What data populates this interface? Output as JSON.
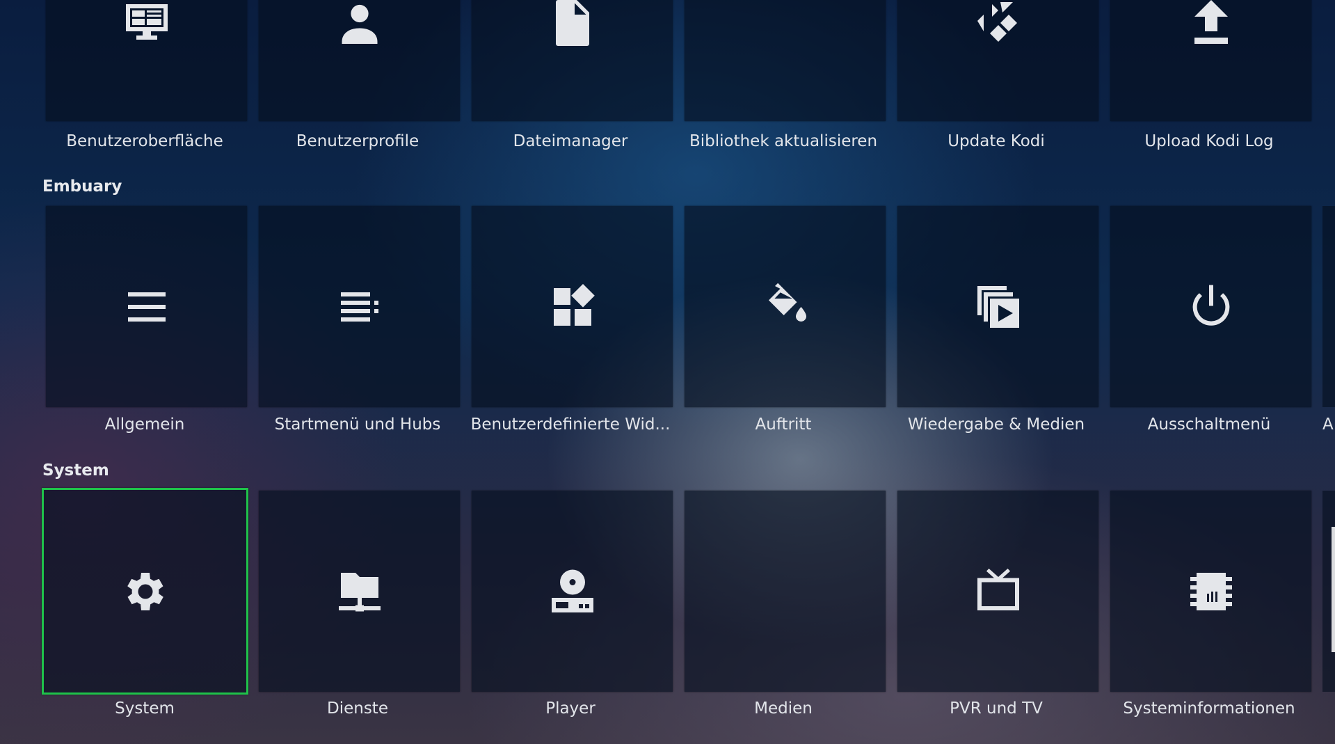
{
  "rows": [
    {
      "label": "",
      "tiles": [
        {
          "label": "Benutzeroberfläche",
          "icon": "monitor-layout-icon"
        },
        {
          "label": "Benutzerprofile",
          "icon": "user-icon"
        },
        {
          "label": "Dateimanager",
          "icon": "file-icon"
        },
        {
          "label": "Bibliothek aktualisieren",
          "icon": ""
        },
        {
          "label": "Update Kodi",
          "icon": "kodi-logo-icon"
        },
        {
          "label": "Upload Kodi Log",
          "icon": "upload-icon"
        }
      ]
    },
    {
      "label": "Embuary",
      "tiles": [
        {
          "label": "Allgemein",
          "icon": "menu-lines-icon"
        },
        {
          "label": "Startmenü und Hubs",
          "icon": "list-menu-icon"
        },
        {
          "label": "Benutzerdefinierte Wid...",
          "icon": "widgets-icon"
        },
        {
          "label": "Auftritt",
          "icon": "paint-bucket-icon"
        },
        {
          "label": "Wiedergabe & Medien",
          "icon": "media-library-icon"
        },
        {
          "label": "Ausschaltmenü",
          "icon": "power-icon"
        },
        {
          "label": "A",
          "icon": ""
        }
      ]
    },
    {
      "label": "System",
      "tiles": [
        {
          "label": "System",
          "icon": "gear-icon",
          "focused": true
        },
        {
          "label": "Dienste",
          "icon": "network-folder-icon"
        },
        {
          "label": "Player",
          "icon": "disc-player-icon"
        },
        {
          "label": "Medien",
          "icon": ""
        },
        {
          "label": "PVR und TV",
          "icon": "tv-icon"
        },
        {
          "label": "Systeminformationen",
          "icon": "chip-icon"
        }
      ]
    }
  ],
  "colors": {
    "focus_border": "#1fc24a",
    "tile_bg": "#050e1e"
  }
}
